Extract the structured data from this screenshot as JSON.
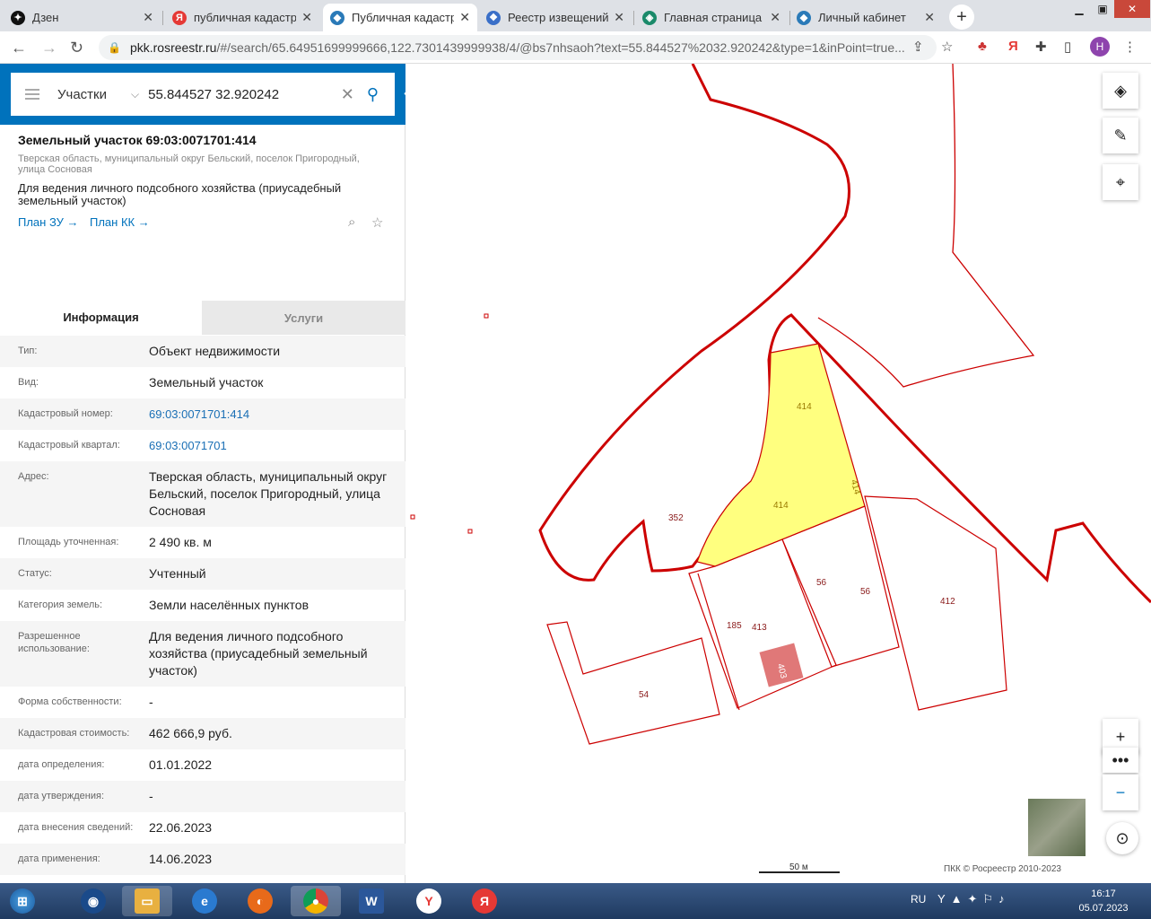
{
  "browser": {
    "tabs": [
      {
        "label": "Дзен",
        "color": "#111",
        "glyph": "✦"
      },
      {
        "label": "публичная кадастро",
        "color": "#e53935",
        "glyph": "Я"
      },
      {
        "label": "Публичная кадастро",
        "color": "#2a7ab8",
        "glyph": "◆"
      },
      {
        "label": "Реестр извещений",
        "color": "#3a6fc8",
        "glyph": "❖"
      },
      {
        "label": "Главная страница",
        "color": "#1a8a6a",
        "glyph": "◈"
      },
      {
        "label": "Личный кабинет",
        "color": "#2a7ab8",
        "glyph": "◆"
      }
    ],
    "url_main": "pkk.rosreestr.ru",
    "url_rest": "/#/search/65.64951699999666,122.7301439999938/4/@bs7nhsaoh?text=55.844527%2032.920242&type=1&inPoint=true...",
    "profile": "Н"
  },
  "search": {
    "type": "Участки",
    "query": "55.844527 32.920242"
  },
  "parcel": {
    "title": "Земельный участок 69:03:0071701:414",
    "address": "Тверская область, муниципальный округ Бельский, поселок Пригородный, улица Сосновая",
    "usage": "Для ведения личного подсобного хозяйства (приусадебный земельный участок)",
    "plan_zu": "План ЗУ →",
    "plan_kk": "План КК →"
  },
  "tabs": {
    "info": "Информация",
    "services": "Услуги"
  },
  "rows": [
    {
      "k": "Тип:",
      "v": "Объект недвижимости"
    },
    {
      "k": "Вид:",
      "v": "Земельный участок"
    },
    {
      "k": "Кадастровый номер:",
      "v": "69:03:0071701:414",
      "link": true
    },
    {
      "k": "Кадастровый квартал:",
      "v": "69:03:0071701",
      "link": true
    },
    {
      "k": "Адрес:",
      "v": "Тверская область, муниципальный округ Бельский, поселок Пригородный, улица Сосновая"
    },
    {
      "k": "Площадь уточненная:",
      "v": "2 490 кв. м"
    },
    {
      "k": "Статус:",
      "v": "Учтенный"
    },
    {
      "k": "Категория земель:",
      "v": "Земли населённых пунктов"
    },
    {
      "k": "Разрешенное использование:",
      "v": "Для ведения личного подсобного хозяйства (приусадебный земельный участок)"
    },
    {
      "k": "Форма собственности:",
      "v": "-"
    },
    {
      "k": "Кадастровая стоимость:",
      "v": "462 666,9 руб."
    },
    {
      "k": "дата определения:",
      "v": "01.01.2022"
    },
    {
      "k": "дата утверждения:",
      "v": "-"
    },
    {
      "k": "дата внесения сведений:",
      "v": "22.06.2023"
    },
    {
      "k": "дата применения:",
      "v": "14.06.2023"
    }
  ],
  "map": {
    "labels": [
      "414",
      "414",
      "414",
      "352",
      "56",
      "56",
      "412",
      "185",
      "413",
      "54",
      "403"
    ],
    "scale": "50 м",
    "copyright": "ПКК © Росреестр 2010-2023"
  },
  "taskbar": {
    "lang": "RU",
    "time": "16:17",
    "date": "05.07.2023"
  },
  "colors": {
    "accent": "#0072bc",
    "parcel_fill": "#ffff7f",
    "boundary": "#cc0000"
  }
}
